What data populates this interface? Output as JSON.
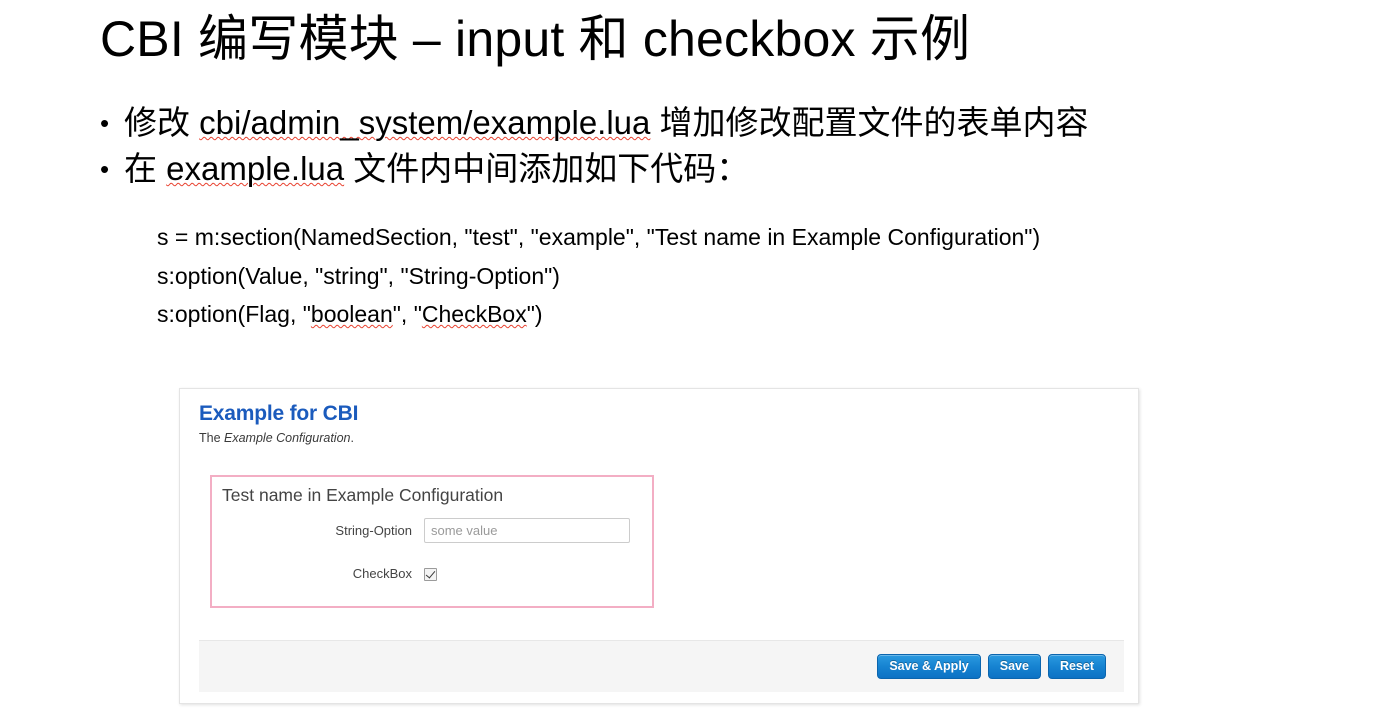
{
  "slide": {
    "title": "CBI 编写模块 – input 和 checkbox 示例",
    "bullet_marker": "•",
    "bullets": [
      {
        "pre": "修改 ",
        "code": "cbi/admin_system/example.lua",
        "post": " 增加修改配置文件的表单内容"
      },
      {
        "pre": "在 ",
        "code": "example.lua",
        "post": " 文件内中间添加如下代码："
      }
    ],
    "code_lines": [
      {
        "plain_1": "s = m:section(NamedSection, \"test\", \"example\", \"Test name in Example Configuration\")",
        "misspelled": "",
        "plain_2": "",
        "plain_3": ""
      },
      {
        "plain_1": "s:option(Value, \"string\", \"String-Option\")",
        "misspelled": "",
        "plain_2": "",
        "plain_3": ""
      },
      {
        "plain_1": "s:option(Flag, \"",
        "misspelled": "boolean",
        "plain_2": "\", \"",
        "misspelled_2": "CheckBox",
        "plain_3": "\")"
      }
    ]
  },
  "cbi_form": {
    "heading": "Example for CBI",
    "description_prefix": "The ",
    "description_em": "Example Configuration",
    "description_suffix": ".",
    "section_legend": "Test name in Example Configuration",
    "fields": [
      {
        "label": "String-Option",
        "type": "text",
        "value": "",
        "placeholder": "some value"
      },
      {
        "label": "CheckBox",
        "type": "checkbox",
        "checked": true
      }
    ],
    "buttons": [
      {
        "label": "Save & Apply"
      },
      {
        "label": "Save"
      },
      {
        "label": "Reset"
      }
    ],
    "colors": {
      "heading": "#1b5bbd",
      "section_border": "#f3aec4",
      "button": "#1683d1",
      "footer_bg": "#f5f5f5"
    }
  }
}
